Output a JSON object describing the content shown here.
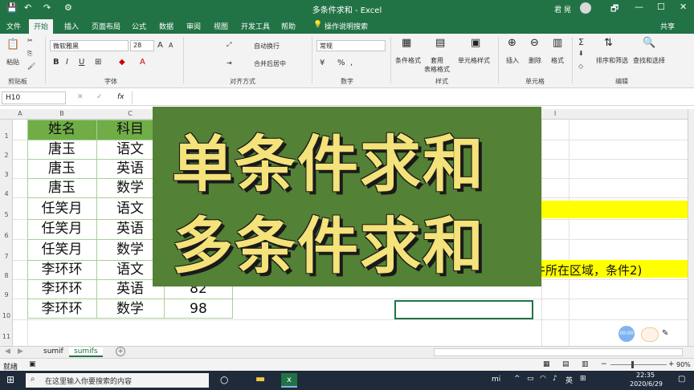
{
  "window": {
    "title": "多条件求和  -  Excel",
    "user": "君 晃",
    "qa_save": "💾",
    "qa_undo": "↶",
    "qa_redo": "↷",
    "qa_misc": "⚙"
  },
  "window_buttons": [
    "🗗",
    "—",
    "☐",
    "✕"
  ],
  "tabs": [
    "文件",
    "开始",
    "插入",
    "页面布局",
    "公式",
    "数据",
    "审阅",
    "视图",
    "开发工具",
    "帮助"
  ],
  "tell_me": "操作说明搜索",
  "share": "共享",
  "ribbon": {
    "paste": "粘贴",
    "clipboard": "剪贴板",
    "font_name": "微软雅黑",
    "font_size": "28",
    "bold": "B",
    "italic": "I",
    "underline": "U",
    "grow": "A",
    "shrink": "A",
    "font_group": "字体",
    "wrap": "自动换行",
    "merge": "合并后居中",
    "align_group": "对齐方式",
    "number_format": "常规",
    "percent": "%",
    "comma": ",",
    "number_group": "数字",
    "cond_format": "条件格式",
    "table_format": "套用\n表格格式",
    "cell_style": "单元格样式",
    "style_group": "样式",
    "insert": "插入",
    "delete": "删除",
    "format": "格式",
    "cells_group": "单元格",
    "sum": "Σ",
    "sort": "排序和筛选",
    "find": "查找和选择",
    "edit_group": "编辑"
  },
  "formula_bar": {
    "name_box": "H10",
    "fx": "fx",
    "cancel": "✕",
    "enter": "✓"
  },
  "columns": [
    "A",
    "B",
    "C",
    "I"
  ],
  "rows": [
    "1",
    "2",
    "3",
    "4",
    "5",
    "6",
    "7",
    "8",
    "9",
    "10",
    "11"
  ],
  "table": {
    "headers": [
      "姓名",
      "科目"
    ],
    "rows": [
      [
        "唐玉",
        "语文"
      ],
      [
        "唐玉",
        "英语"
      ],
      [
        "唐玉",
        "数学"
      ],
      [
        "任笑月",
        "语文"
      ],
      [
        "任笑月",
        "英语"
      ],
      [
        "任笑月",
        "数学"
      ],
      [
        "李环环",
        "语文"
      ],
      [
        "李环环",
        "英语",
        "82"
      ],
      [
        "李环环",
        "数学",
        "98"
      ]
    ]
  },
  "overlay": {
    "line1": "单条件求和",
    "line2": "多条件求和"
  },
  "partial_text": "件所在区域，条件2)",
  "sheets": [
    "sumif",
    "sumifs"
  ],
  "add_sheet": "+",
  "status": {
    "ready": "就绪",
    "zoom": "90%"
  },
  "taskbar": {
    "search_placeholder": "在这里输入你要搜索的内容",
    "ime": "英",
    "time": "22:35",
    "date": "2020/6/29"
  },
  "rec_badge": "00:00"
}
